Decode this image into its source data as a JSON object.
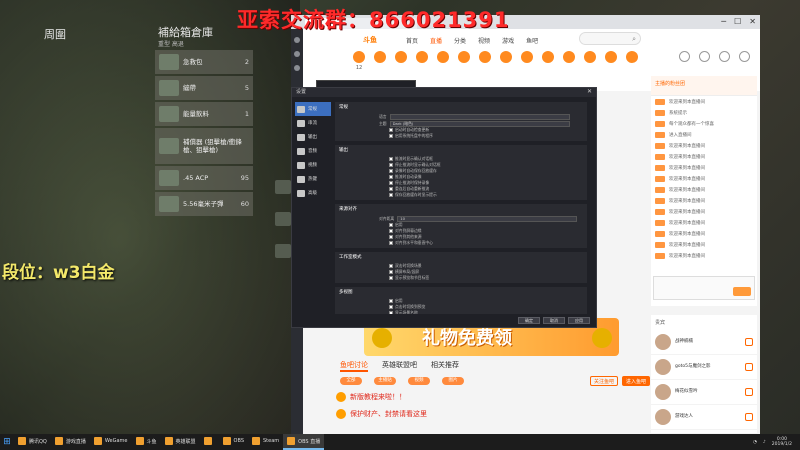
{
  "overlay": {
    "qq_group": "亚索交流群：866021391",
    "rank": "段位：w3白金"
  },
  "game": {
    "nearby_title": "周圍",
    "crate_title": "補給箱倉庫",
    "crate_sub": "重型 高退",
    "items": [
      {
        "name": "急救包",
        "count": "2"
      },
      {
        "name": "繃帶",
        "count": "5"
      },
      {
        "name": "能量飲料",
        "count": "1"
      },
      {
        "name": "補償器 (狙擊槍/衝鋒槍、狙擊槍)",
        "count": ""
      },
      {
        "name": ".45 ACP",
        "count": "95"
      },
      {
        "name": "5.56毫米子彈",
        "count": "60"
      }
    ]
  },
  "browser": {
    "site_logo": "斗鱼",
    "nav": [
      "首页",
      "直播",
      "分类",
      "视频",
      "游戏",
      "鱼吧"
    ],
    "categories": [
      "12",
      "",
      "",
      "",
      "",
      "",
      "",
      "",
      "",
      "",
      "",
      "",
      "",
      ""
    ]
  },
  "settings": {
    "title": "设置",
    "close": "✕",
    "nav": [
      {
        "label": "常规",
        "icon": "gear-icon"
      },
      {
        "label": "串流",
        "icon": "stream-icon"
      },
      {
        "label": "输出",
        "icon": "output-icon"
      },
      {
        "label": "音频",
        "icon": "audio-icon"
      },
      {
        "label": "视频",
        "icon": "video-icon"
      },
      {
        "label": "热键",
        "icon": "keyboard-icon"
      },
      {
        "label": "高级",
        "icon": "tools-icon"
      }
    ],
    "sections": [
      {
        "title": "常规",
        "fields": [
          {
            "label": "语言",
            "value": ""
          },
          {
            "label": "主题",
            "value": "Dark (暗色)"
          }
        ],
        "options": [
          "启动时自动检查更新",
          "启用系统托盘中的程序"
        ]
      },
      {
        "title": "输出",
        "fields": [],
        "options": [
          "推流时显示确认对话框",
          "停止推流时显示确认对话框",
          "录像时自动保存回放缓存",
          "推流时自动录像",
          "停止推流时保持录像",
          "重连后自动重新推流",
          "保存回放缓存时显示提示"
        ]
      },
      {
        "title": "来源对齐",
        "fields": [
          {
            "label": "对齐距离",
            "value": "10"
          }
        ],
        "options": [
          "启用",
          "对齐到屏幕边缘",
          "对齐到其他来源",
          "对齐到水平和垂直中心"
        ]
      },
      {
        "title": "工作室模式",
        "fields": [],
        "options": [
          "双击时切换场景",
          "横屏布局/竖屏",
          "显示预览和节目标签"
        ]
      },
      {
        "title": "多视图",
        "fields": [],
        "options": [
          "启用",
          "点击时切换到预览",
          "显示场景名称"
        ]
      }
    ],
    "footer": [
      "确定",
      "取消",
      "应用"
    ]
  },
  "page": {
    "banner_text": "礼物免费领",
    "tabs": [
      "鱼吧讨论",
      "英雄联盟吧",
      "相关推荐"
    ],
    "pills": [
      "全部",
      "主播贴",
      "视频",
      "图片"
    ],
    "follow_buttons": [
      "关注鱼吧",
      "进入鱼吧"
    ],
    "notices": [
      "新版教程来啦！！",
      "保护财产、封禁请看这里"
    ]
  },
  "chat": {
    "head": "主播的粉丝团",
    "lines": [
      {
        "name": "",
        "text": "欢迎来到本直播间"
      },
      {
        "name": "",
        "text": "系统提示"
      },
      {
        "name": "",
        "text": "每个观众都有一个惊喜"
      },
      {
        "name": "",
        "text": "进入直播间"
      },
      {
        "name": "",
        "text": "欢迎来到本直播间"
      },
      {
        "name": "",
        "text": "欢迎来到本直播间"
      },
      {
        "name": "",
        "text": "欢迎来到本直播间"
      },
      {
        "name": "",
        "text": "欢迎来到本直播间"
      },
      {
        "name": "",
        "text": "欢迎来到本直播间"
      },
      {
        "name": "",
        "text": "欢迎来到本直播间"
      },
      {
        "name": "",
        "text": "欢迎来到本直播间"
      },
      {
        "name": "",
        "text": "欢迎来到本直播间"
      },
      {
        "name": "",
        "text": "欢迎来到本直播间"
      },
      {
        "name": "",
        "text": "欢迎来到本直播间"
      },
      {
        "name": "",
        "text": "欢迎来到本直播间"
      }
    ]
  },
  "guests": {
    "head": "贵宾",
    "rows": [
      {
        "name": "战神楠楠"
      },
      {
        "name": "goto5与魔剑之影"
      },
      {
        "name": "梅花似雪吟"
      },
      {
        "name": "游戏达人"
      }
    ]
  },
  "taskbar": {
    "start": "⊞",
    "tasks": [
      "腾讯QQ",
      "游戏直播",
      "WeGame",
      "斗鱼",
      "英雄联盟",
      "",
      "OBS",
      "Steam",
      "OBS 直播"
    ],
    "active_index": 8,
    "time": "0:00",
    "date": "2019/1/2"
  }
}
